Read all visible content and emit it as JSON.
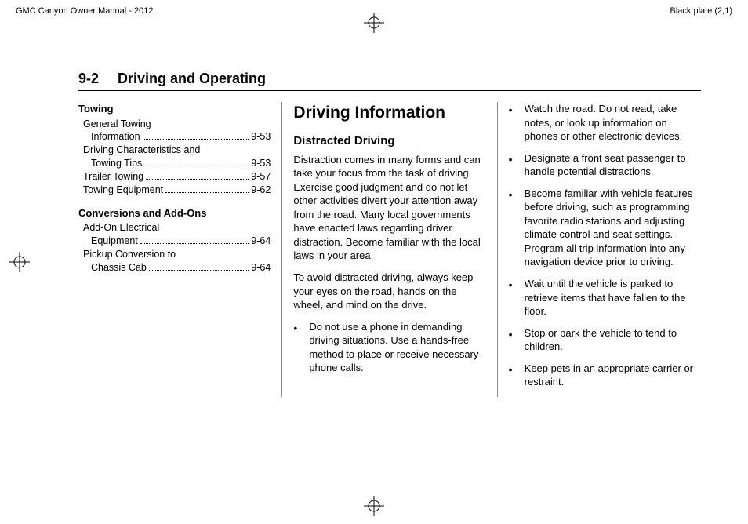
{
  "meta": {
    "doc_title": "GMC Canyon Owner Manual - 2012",
    "plate": "Black plate (2,1)"
  },
  "header": {
    "page_num": "9-2",
    "section": "Driving and Operating"
  },
  "toc": {
    "sections": [
      {
        "heading": "Towing",
        "items": [
          {
            "label_a": "General Towing",
            "label_b": "Information",
            "page": "9-53",
            "wrap": true
          },
          {
            "label_a": "Driving Characteristics and",
            "label_b": "Towing Tips",
            "page": "9-53",
            "wrap": true
          },
          {
            "label_a": "Trailer Towing",
            "page": "9-57",
            "wrap": false
          },
          {
            "label_a": "Towing Equipment",
            "page": "9-62",
            "wrap": false
          }
        ]
      },
      {
        "heading": "Conversions and Add-Ons",
        "items": [
          {
            "label_a": "Add-On Electrical",
            "label_b": "Equipment",
            "page": "9-64",
            "wrap": true
          },
          {
            "label_a": "Pickup Conversion to",
            "label_b": "Chassis Cab",
            "page": "9-64",
            "wrap": true
          }
        ]
      }
    ]
  },
  "body": {
    "title": "Driving Information",
    "subheading": "Distracted Driving",
    "paragraphs": [
      "Distraction comes in many forms and can take your focus from the task of driving. Exercise good judgment and do not let other activities divert your attention away from the road. Many local governments have enacted laws regarding driver distraction. Become familiar with the local laws in your area.",
      "To avoid distracted driving, always keep your eyes on the road, hands on the wheel, and mind on the drive."
    ],
    "bullets": [
      "Do not use a phone in demanding driving situations. Use a hands-free method to place or receive necessary phone calls.",
      "Watch the road. Do not read, take notes, or look up information on phones or other electronic devices.",
      "Designate a front seat passenger to handle potential distractions.",
      "Become familiar with vehicle features before driving, such as programming favorite radio stations and adjusting climate control and seat settings. Program all trip information into any navigation device prior to driving.",
      "Wait until the vehicle is parked to retrieve items that have fallen to the floor.",
      "Stop or park the vehicle to tend to children.",
      "Keep pets in an appropriate carrier or restraint."
    ]
  }
}
